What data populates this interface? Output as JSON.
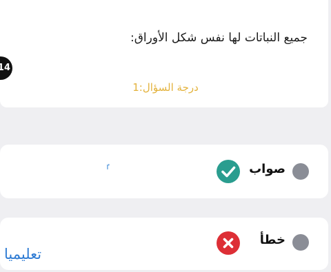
{
  "question": {
    "number": "14",
    "text": "جميع النباتات لها نفس شكل الأوراق:",
    "grade": "درجة السؤال:1"
  },
  "options": [
    {
      "label": "صواب",
      "status_icon": "check-icon",
      "status_color": "#2a9d8f"
    },
    {
      "label": "خطأ",
      "status_icon": "cross-icon",
      "status_color": "#dd2f36"
    }
  ],
  "colors": {
    "grade_text": "#e3b23c",
    "radio": "#8a8d96",
    "watermark": "#2e7bd3"
  },
  "stray_mark": "ٵ",
  "watermark": "تعليميا"
}
